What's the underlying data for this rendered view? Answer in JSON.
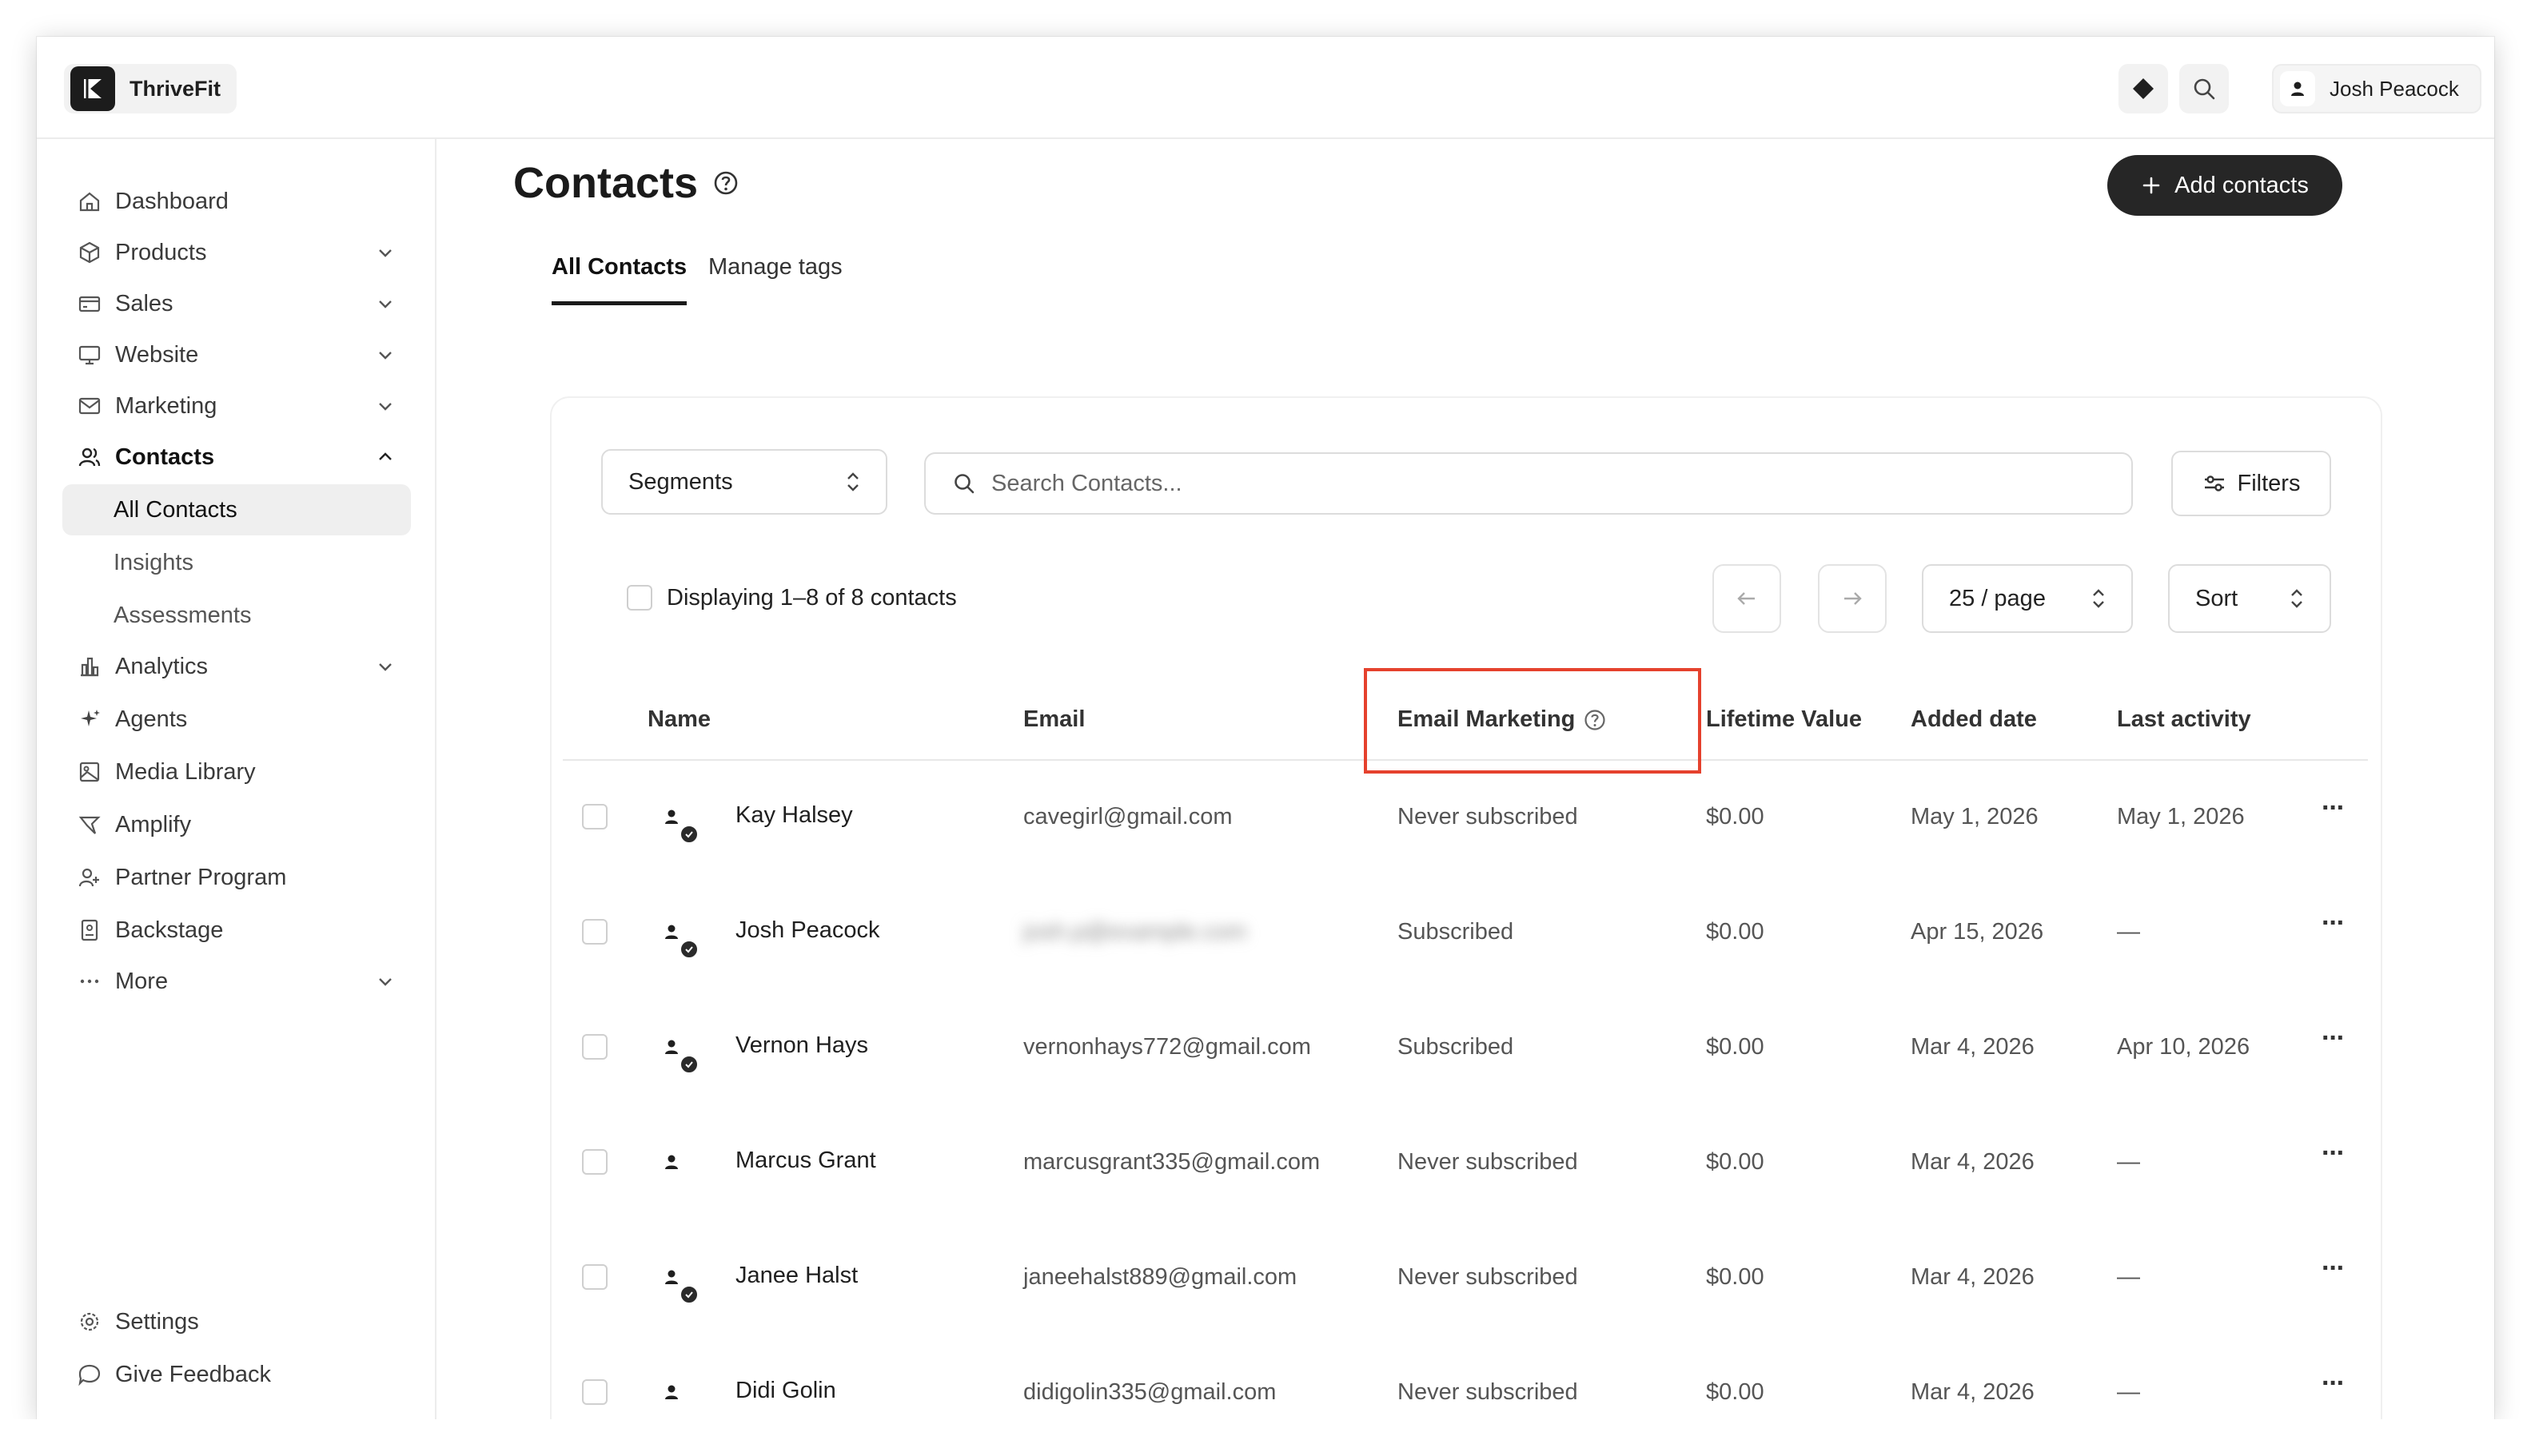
{
  "app": {
    "name": "ThriveFit"
  },
  "topbar": {
    "user_name": "Josh Peacock"
  },
  "sidebar": {
    "items": [
      {
        "label": "Dashboard"
      },
      {
        "label": "Products"
      },
      {
        "label": "Sales"
      },
      {
        "label": "Website"
      },
      {
        "label": "Marketing"
      },
      {
        "label": "Contacts"
      },
      {
        "label": "All Contacts"
      },
      {
        "label": "Insights"
      },
      {
        "label": "Assessments"
      },
      {
        "label": "Analytics"
      },
      {
        "label": "Agents"
      },
      {
        "label": "Media Library"
      },
      {
        "label": "Amplify"
      },
      {
        "label": "Partner Program"
      },
      {
        "label": "Backstage"
      },
      {
        "label": "More"
      }
    ],
    "footer": {
      "settings": "Settings",
      "feedback": "Give Feedback"
    }
  },
  "page": {
    "title": "Contacts",
    "add_button": "Add contacts",
    "tabs": [
      {
        "label": "All Contacts"
      },
      {
        "label": "Manage tags"
      }
    ]
  },
  "toolbar": {
    "segments": "Segments",
    "search_placeholder": "Search Contacts...",
    "filters": "Filters",
    "display_text": "Displaying 1–8 of 8 contacts",
    "per_page": "25 / page",
    "sort": "Sort"
  },
  "table": {
    "headers": {
      "name": "Name",
      "email": "Email",
      "email_marketing": "Email Marketing",
      "lifetime_value": "Lifetime Value",
      "added_date": "Added date",
      "last_activity": "Last activity"
    },
    "rows": [
      {
        "name": "Kay Halsey",
        "email": "cavegirl@gmail.com",
        "marketing": "Never subscribed",
        "value": "$0.00",
        "added": "May 1, 2026",
        "last": "May 1, 2026"
      },
      {
        "name": "Josh Peacock",
        "email": "josh.p@example.com",
        "marketing": "Subscribed",
        "value": "$0.00",
        "added": "Apr 15, 2026",
        "last": "—"
      },
      {
        "name": "Vernon Hays",
        "email": "vernonhays772@gmail.com",
        "marketing": "Subscribed",
        "value": "$0.00",
        "added": "Mar 4, 2026",
        "last": "Apr 10, 2026"
      },
      {
        "name": "Marcus Grant",
        "email": "marcusgrant335@gmail.com",
        "marketing": "Never subscribed",
        "value": "$0.00",
        "added": "Mar 4, 2026",
        "last": "—"
      },
      {
        "name": "Janee Halst",
        "email": "janeehalst889@gmail.com",
        "marketing": "Never subscribed",
        "value": "$0.00",
        "added": "Mar 4, 2026",
        "last": "—"
      },
      {
        "name": "Didi Golin",
        "email": "didigolin335@gmail.com",
        "marketing": "Never subscribed",
        "value": "$0.00",
        "added": "Mar 4, 2026",
        "last": "—"
      }
    ]
  },
  "colors": {
    "highlight": "#e5412d",
    "primary_button": "#262626"
  }
}
